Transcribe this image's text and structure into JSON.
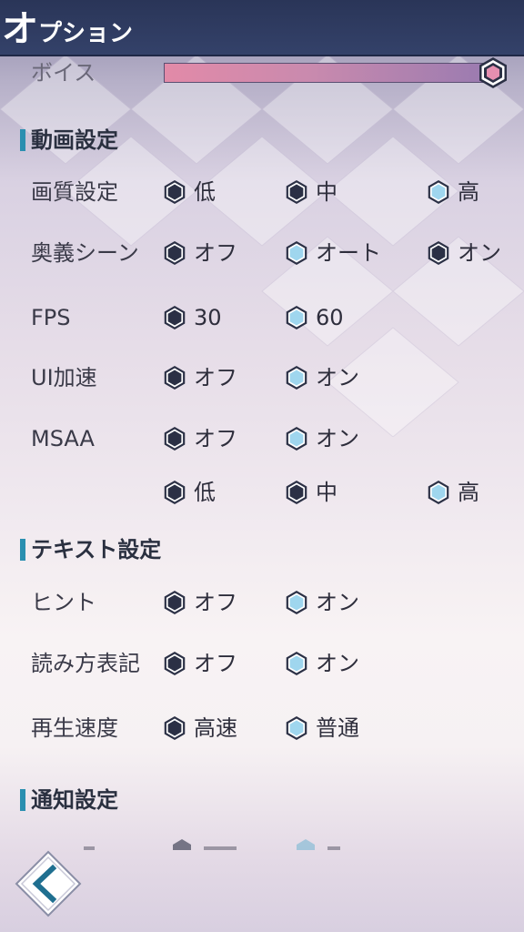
{
  "header": {
    "title_first": "オ",
    "title_rest": "プション"
  },
  "voice": {
    "label": "ボイス",
    "level": 1.0
  },
  "sections": {
    "video": {
      "title": "動画設定"
    },
    "text": {
      "title": "テキスト設定"
    },
    "notify": {
      "title": "通知設定"
    }
  },
  "rows": {
    "quality": {
      "label": "画質設定",
      "options": [
        "低",
        "中",
        "高"
      ],
      "selected": 2
    },
    "ougi": {
      "label": "奥義シーン",
      "options": [
        "オフ",
        "オート",
        "オン"
      ],
      "selected": 1
    },
    "fps": {
      "label": "FPS",
      "options": [
        "30",
        "60"
      ],
      "selected": 1
    },
    "ui_accel": {
      "label": "UI加速",
      "options": [
        "オフ",
        "オン"
      ],
      "selected": 1
    },
    "msaa": {
      "label": "MSAA",
      "options": [
        "オフ",
        "オン"
      ],
      "selected": 1
    },
    "msaa_level": {
      "label": "",
      "options": [
        "低",
        "中",
        "高"
      ],
      "selected": 2
    },
    "hint": {
      "label": "ヒント",
      "options": [
        "オフ",
        "オン"
      ],
      "selected": 1
    },
    "reading": {
      "label": "読み方表記",
      "options": [
        "オフ",
        "オン"
      ],
      "selected": 1
    },
    "speed": {
      "label": "再生速度",
      "options": [
        "高速",
        "普通"
      ],
      "selected": 1
    }
  },
  "colors": {
    "header": "#2a3558",
    "accent": "#2a8fb0",
    "radio_off": "#2b3045",
    "radio_on": "#9fd6ee",
    "slider_start": "#e28aa8",
    "slider_end": "#9a7bb0"
  },
  "icons": {
    "back": "chevron-left-icon",
    "radio_off": "hexagon-dark-icon",
    "radio_on": "hexagon-light-blue-icon",
    "slider_knob": "hexagon-pink-knob-icon"
  }
}
